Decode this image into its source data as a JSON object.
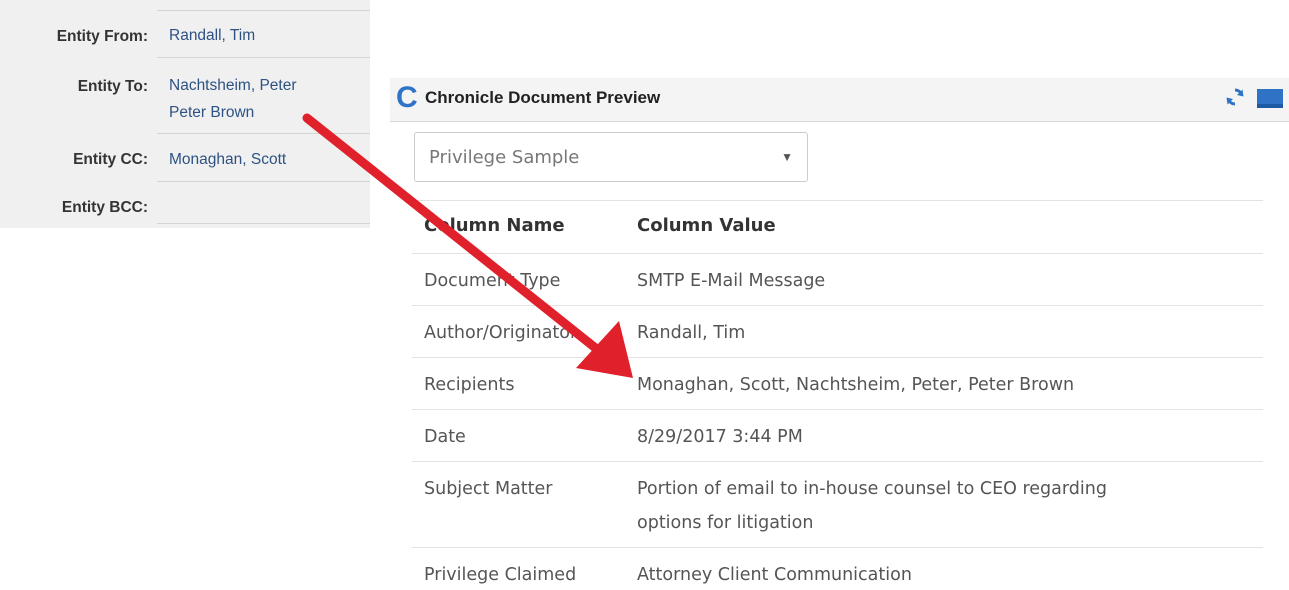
{
  "entity_panel": {
    "rows": [
      {
        "label": "Entity From:",
        "values": [
          "Randall, Tim"
        ]
      },
      {
        "label": "Entity To:",
        "values": [
          "Nachtsheim, Peter",
          "Peter Brown"
        ]
      },
      {
        "label": "Entity CC:",
        "values": [
          "Monaghan, Scott"
        ]
      },
      {
        "label": "Entity BCC:",
        "values": []
      }
    ]
  },
  "preview": {
    "logo": "C",
    "title": "Chronicle Document Preview",
    "icons": {
      "refresh": "refresh-icon",
      "minimize": "minimize-icon"
    },
    "colors": {
      "accent": "#2f73c7",
      "arrow": "#e0202a",
      "link": "#2d5283"
    },
    "select": {
      "value": "Privilege Sample",
      "caret": "▼"
    },
    "table": {
      "headers": [
        "Column Name",
        "Column Value"
      ],
      "rows": [
        [
          "Document Type",
          "SMTP E-Mail Message"
        ],
        [
          "Author/Originator",
          "Randall, Tim"
        ],
        [
          "Recipients",
          "Monaghan, Scott, Nachtsheim, Peter, Peter Brown"
        ],
        [
          "Date",
          "8/29/2017 3:44 PM"
        ],
        [
          "Subject Matter",
          "Portion of email to in-house counsel to CEO regarding",
          "options for litigation"
        ],
        [
          "Privilege Claimed",
          "Attorney Client Communication"
        ]
      ]
    }
  }
}
